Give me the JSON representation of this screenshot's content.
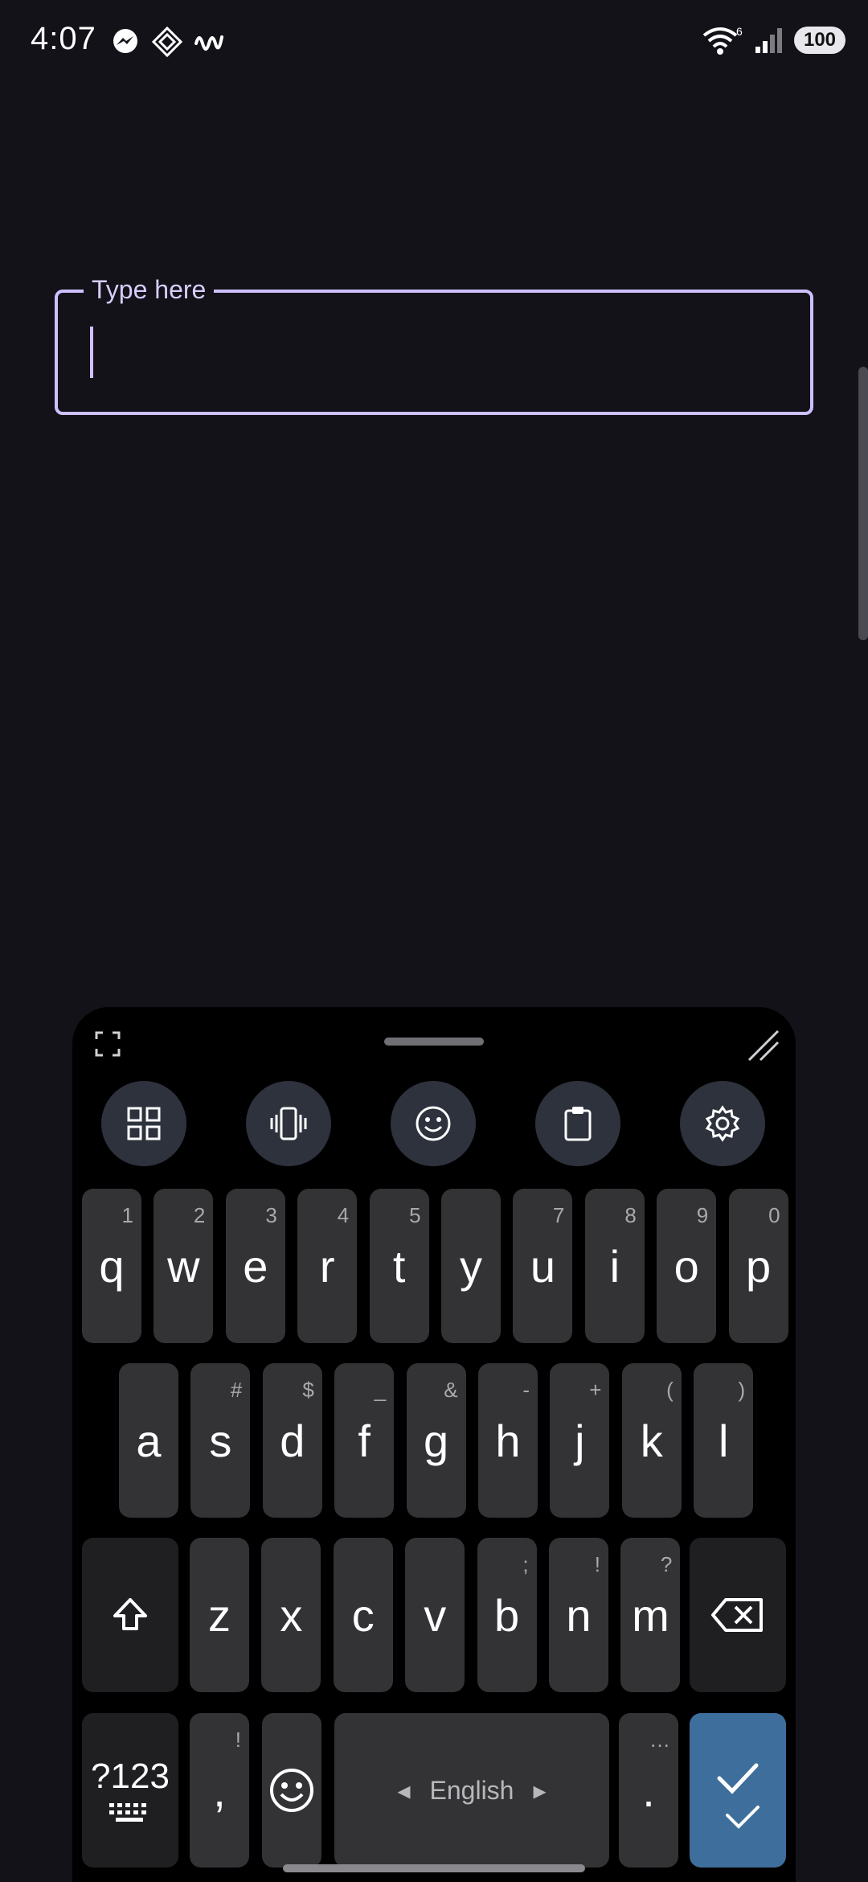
{
  "status": {
    "time": "4:07",
    "battery": "100",
    "network_label": "6"
  },
  "field": {
    "label": "Type here"
  },
  "keyboard": {
    "row1": [
      {
        "k": "q",
        "h": "1"
      },
      {
        "k": "w",
        "h": "2"
      },
      {
        "k": "e",
        "h": "3"
      },
      {
        "k": "r",
        "h": "4"
      },
      {
        "k": "t",
        "h": "5"
      },
      {
        "k": "y",
        "h": ""
      },
      {
        "k": "u",
        "h": "7"
      },
      {
        "k": "i",
        "h": "8"
      },
      {
        "k": "o",
        "h": "9"
      },
      {
        "k": "p",
        "h": "0"
      }
    ],
    "row2": [
      {
        "k": "a",
        "h": ""
      },
      {
        "k": "s",
        "h": "#"
      },
      {
        "k": "d",
        "h": "$"
      },
      {
        "k": "f",
        "h": "_"
      },
      {
        "k": "g",
        "h": "&"
      },
      {
        "k": "h",
        "h": "-"
      },
      {
        "k": "j",
        "h": "+"
      },
      {
        "k": "k",
        "h": "("
      },
      {
        "k": "l",
        "h": ")"
      }
    ],
    "row3": [
      {
        "k": "z",
        "h": ""
      },
      {
        "k": "x",
        "h": ""
      },
      {
        "k": "c",
        "h": ""
      },
      {
        "k": "v",
        "h": ""
      },
      {
        "k": "b",
        "h": ";"
      },
      {
        "k": "n",
        "h": "!"
      },
      {
        "k": "m",
        "h": "?"
      }
    ],
    "symbols_label": "?123",
    "comma": {
      "k": ",",
      "h": "!"
    },
    "space_label": "English",
    "period": {
      "k": ".",
      "h": "…"
    },
    "tools": [
      "grid-icon",
      "vibrate-icon",
      "emoji-icon",
      "clipboard-icon",
      "settings-icon"
    ],
    "accent_color": "#3e6e9b",
    "field_color": "#cfc0ff"
  }
}
